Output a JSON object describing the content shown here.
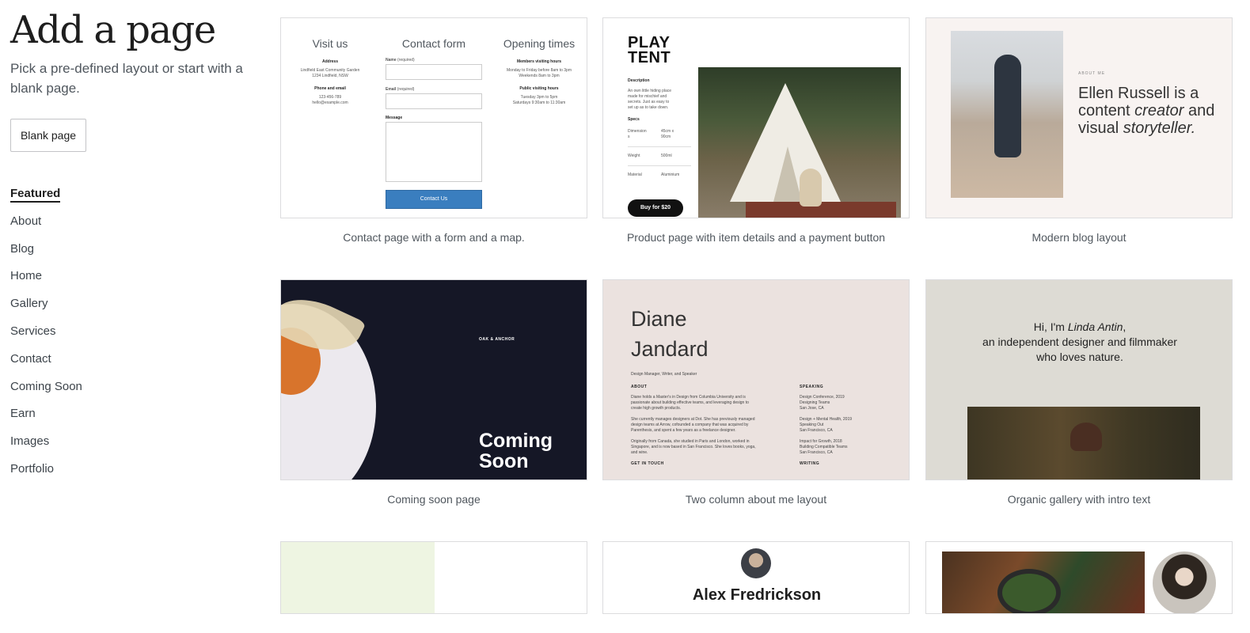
{
  "sidebar": {
    "title": "Add a page",
    "subtitle": "Pick a pre-defined layout or start with a blank page.",
    "blank_button": "Blank page",
    "categories": [
      {
        "label": "Featured",
        "active": true
      },
      {
        "label": "About"
      },
      {
        "label": "Blog"
      },
      {
        "label": "Home"
      },
      {
        "label": "Gallery"
      },
      {
        "label": "Services"
      },
      {
        "label": "Contact"
      },
      {
        "label": "Coming Soon"
      },
      {
        "label": "Earn"
      },
      {
        "label": "Images"
      },
      {
        "label": "Portfolio"
      }
    ]
  },
  "layouts": {
    "contact": {
      "caption": "Contact page with a form and a map.",
      "visit_heading": "Visit us",
      "form_heading": "Contact form",
      "hours_heading": "Opening times",
      "address_label": "Address",
      "address_line1": "Lindfield East Community Garden",
      "address_line2": "1234 Lindfield, NSW",
      "phone_label": "Phone and email",
      "phone": "123-456-789",
      "email": "hello@example.com",
      "name_field": "Name",
      "email_field": "Email",
      "message_field": "Message",
      "required": "(required)",
      "button": "Contact Us",
      "members_label": "Members visiting hours",
      "members_line1": "Monday to Friday before 8am to 3pm",
      "members_line2": "Weekends 8am to 3pm",
      "public_label": "Public visiting hours",
      "public_line1": "Tuesday 3pm to 5pm",
      "public_line2": "Saturdays 9:30am to 11:30am"
    },
    "product": {
      "caption": "Product page with item details and a payment button",
      "title": "PLAY\nTENT",
      "desc_label": "Description",
      "desc_text": "An own little hiding place\nmade for mischief and\nsecrets. Just as easy to\nset up as to take down.",
      "specs_label": "Specs",
      "dim_label": "Dimension\ns",
      "dim_value": "45cm x\n90cm",
      "weight_label": "Weight",
      "weight_value": "500ml",
      "material_label": "Material",
      "material_value": "Aluminium",
      "button": "Buy for $20"
    },
    "blog": {
      "caption": "Modern blog layout",
      "about_label": "ABOUT ME",
      "text_a": "Ellen Russell is a content ",
      "text_b": "creator",
      "text_c": " and visual ",
      "text_d": "storyteller."
    },
    "coming_soon": {
      "caption": "Coming soon page",
      "brand": "OAK & ANCHOR",
      "title": "Coming\nSoon"
    },
    "about": {
      "caption": "Two column about me layout",
      "name": "Diane\nJandard",
      "role": "Design Manager, Writer, and Speaker",
      "about_heading": "ABOUT",
      "about_p1": "Diane holds a Master's in Design from Columbia University and is\npassionate about building effective teams, and leveraging design to\ncreate high growth products.",
      "about_p2": "She currently manages designers at Dot. She has previously managed\ndesign teams at Arrow, cofounded a company that was acquired by\nParenthesis, and spent a few years as a freelance designer.",
      "about_p3": "Originally from Canada, she studied in Paris and London, worked in\nSingapore, and is now based in San Francisco. She loves books, yoga,\nand wine.",
      "touch_heading": "GET IN TOUCH",
      "speaking_heading": "SPEAKING",
      "speaking_1": "Design Conference, 2019\nDesigning Teams\nSan Jose, CA",
      "speaking_2": "Design + Mental Health, 2019\nSpeaking Out\nSan Francisco, CA",
      "speaking_3": "Impact for Growth, 2018\nBuilding Compatible Teams\nSan Francisco, CA",
      "writing_heading": "WRITING"
    },
    "gallery": {
      "caption": "Organic gallery with intro text",
      "intro_a": "Hi, I'm ",
      "intro_name": "Linda Antin",
      "intro_b": ",",
      "intro_line2": "an independent designer and filmmaker",
      "intro_line3": "who loves nature."
    },
    "row3_middle": {
      "name": "Alex Fredrickson"
    }
  },
  "colors": {
    "contact_button": "#3a7ebf",
    "coming_soon_bg": "#151726",
    "about_bg": "#ebe2df",
    "gallery_bg": "#dddbd4",
    "blog_bg": "#f8f3f1"
  }
}
